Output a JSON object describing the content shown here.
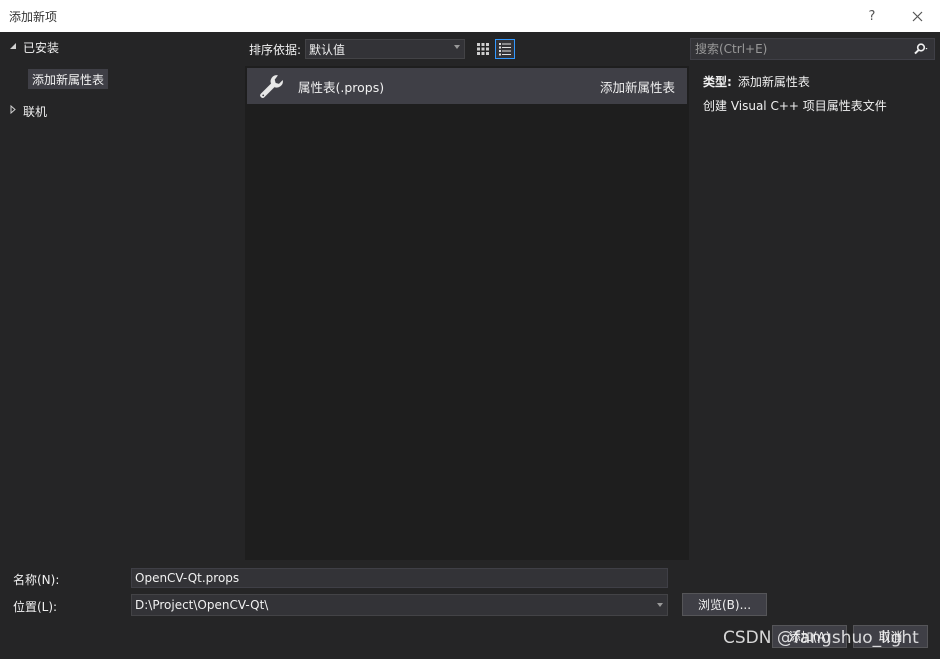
{
  "window": {
    "title": "添加新项",
    "help_label": "?",
    "close_label": "✕"
  },
  "tree": {
    "installed_label": "已安装",
    "child_label": "添加新属性表",
    "online_label": "联机"
  },
  "toolbar": {
    "sort_label": "排序依据:",
    "sort_value": "默认值",
    "search_placeholder": "搜索(Ctrl+E)"
  },
  "templates": [
    {
      "name": "属性表(.props)",
      "type": "添加新属性表",
      "icon": "wrench-icon"
    }
  ],
  "details": {
    "type_label": "类型:",
    "type_value": "添加新属性表",
    "description": "创建 Visual C++ 项目属性表文件"
  },
  "form": {
    "name_label": "名称(N):",
    "name_value": "OpenCV-Qt.props",
    "location_label": "位置(L):",
    "location_value": "D:\\Project\\OpenCV-Qt\\",
    "browse_label": "浏览(B)...",
    "add_label": "添加(A)",
    "cancel_label": "取消"
  },
  "watermark": "CSDN @fangshuo_light",
  "colors": {
    "background": "#252526",
    "list_background": "#1e1e1e",
    "selection": "#3f3f46",
    "accent": "#3399ff"
  }
}
